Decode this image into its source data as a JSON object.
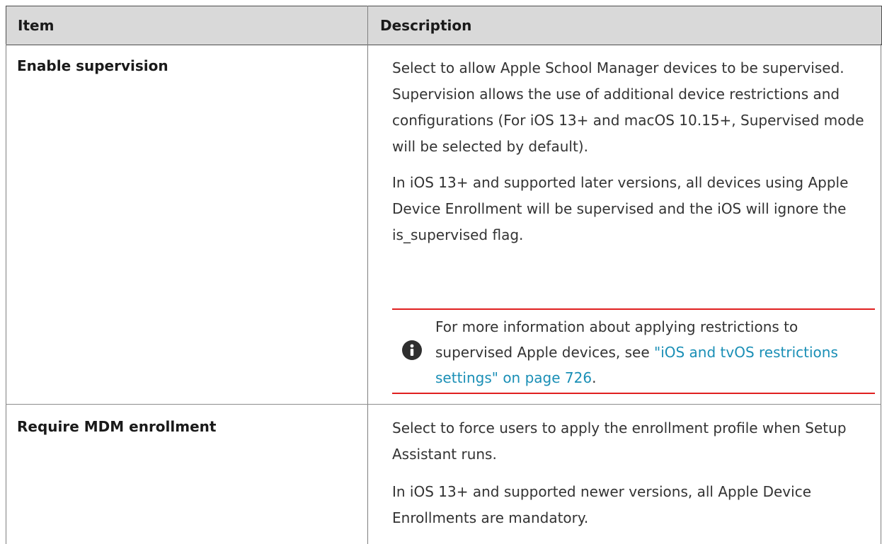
{
  "table": {
    "headers": {
      "item": "Item",
      "description": "Description"
    },
    "rows": [
      {
        "item": "Enable supervision",
        "paragraphs": [
          "Select to allow Apple School Manager devices to be supervised. Supervision allows the use of additional device restrictions and configurations (For iOS 13+ and macOS 10.15+, Supervised mode will be selected by default).",
          "In iOS 13+ and supported later versions, all devices using Apple Device Enrollment will be supervised and the iOS will ignore the is_supervised flag."
        ],
        "note": {
          "icon": "info-icon",
          "text_before": "For more information about applying restrictions to supervised Apple devices, see ",
          "link_text": "\"iOS and tvOS restrictions settings\" on page 726",
          "text_after": "."
        }
      },
      {
        "item": "Require MDM enrollment",
        "paragraphs": [
          "Select to force users to apply the enrollment profile when Setup Assistant runs.",
          "In iOS 13+ and supported newer versions, all Apple Device Enrollments are mandatory."
        ]
      }
    ]
  },
  "colors": {
    "header_background": "#d9d9d9",
    "note_rule": "#e02020",
    "link": "#1a8fb6"
  }
}
